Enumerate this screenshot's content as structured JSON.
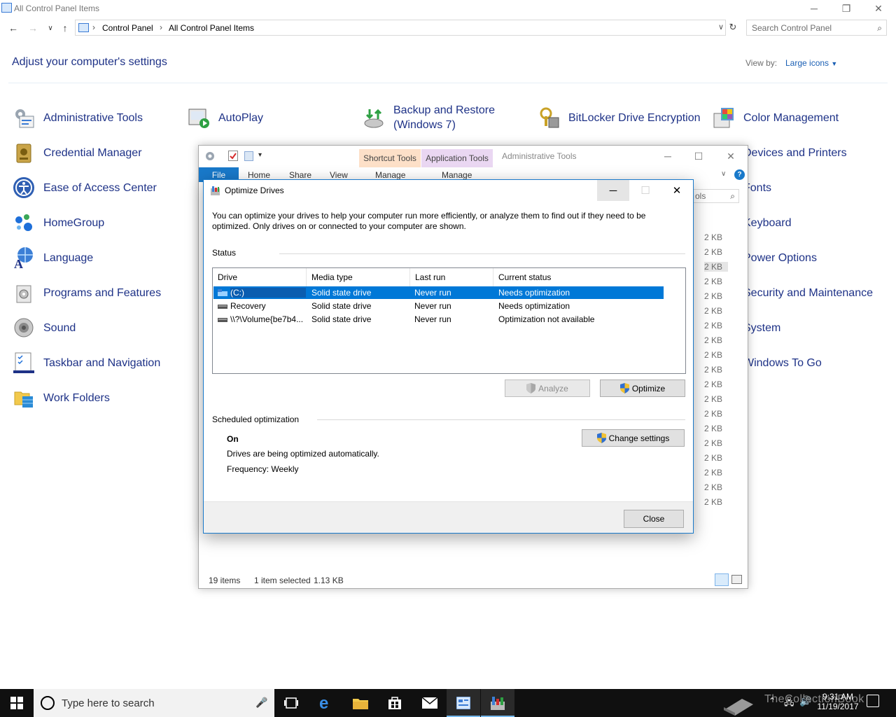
{
  "window": {
    "title": "All Control Panel Items"
  },
  "address": {
    "crumbs": [
      "Control Panel",
      "All Control Panel Items"
    ]
  },
  "search": {
    "placeholder": "Search Control Panel"
  },
  "heading": "Adjust your computer's settings",
  "view_by": {
    "label": "View by:",
    "value": "Large icons"
  },
  "items": [
    {
      "label": "Administrative Tools",
      "icon": "administrative-tools-icon"
    },
    {
      "label": "AutoPlay",
      "icon": "autoplay-icon"
    },
    {
      "label": "Backup and Restore (Windows 7)",
      "icon": "backup-restore-icon"
    },
    {
      "label": "BitLocker Drive Encryption",
      "icon": "bitlocker-icon"
    },
    {
      "label": "Color Management",
      "icon": "color-management-icon"
    },
    {
      "label": "Credential Manager",
      "icon": "credential-manager-icon"
    },
    {
      "label": "Devices and Printers",
      "icon": "devices-printers-icon"
    },
    {
      "label": "Ease of Access Center",
      "icon": "ease-of-access-icon"
    },
    {
      "label": "Fonts",
      "icon": "fonts-icon"
    },
    {
      "label": "HomeGroup",
      "icon": "homegroup-icon"
    },
    {
      "label": "Keyboard",
      "icon": "keyboard-icon"
    },
    {
      "label": "Language",
      "icon": "language-icon"
    },
    {
      "label": "Power Options",
      "icon": "power-options-icon"
    },
    {
      "label": "Programs and Features",
      "icon": "programs-features-icon"
    },
    {
      "label": "Security and Maintenance",
      "icon": "security-maintenance-icon"
    },
    {
      "label": "Sound",
      "icon": "sound-icon"
    },
    {
      "label": "System",
      "icon": "system-icon"
    },
    {
      "label": "Taskbar and Navigation",
      "icon": "taskbar-navigation-icon"
    },
    {
      "label": "Windows To Go",
      "icon": "windows-to-go-icon"
    },
    {
      "label": "Work Folders",
      "icon": "work-folders-icon"
    }
  ],
  "explorer": {
    "tabs": {
      "shortcut": "Shortcut Tools",
      "application": "Application Tools"
    },
    "title": "Administrative Tools",
    "ribbon": {
      "file": "File",
      "home": "Home",
      "share": "Share",
      "view": "View",
      "manage1": "Manage",
      "manage2": "Manage"
    },
    "search_partial": "ols",
    "size": "2 KB",
    "status": {
      "count": "19 items",
      "selected": "1 item selected",
      "size": "1.13 KB"
    }
  },
  "dialog": {
    "title": "Optimize Drives",
    "description": "You can optimize your drives to help your computer run more efficiently, or analyze them to find out if they need to be optimized. Only drives on or connected to your computer are shown.",
    "status_label": "Status",
    "columns": [
      "Drive",
      "Media type",
      "Last run",
      "Current status"
    ],
    "drives": [
      {
        "drive": "(C:)",
        "media": "Solid state drive",
        "last_run": "Never run",
        "status": "Needs optimization"
      },
      {
        "drive": "Recovery",
        "media": "Solid state drive",
        "last_run": "Never run",
        "status": "Needs optimization"
      },
      {
        "drive": "\\\\?\\Volume{be7b4...",
        "media": "Solid state drive",
        "last_run": "Never run",
        "status": "Optimization not available"
      }
    ],
    "analyze_label": "Analyze",
    "optimize_label": "Optimize",
    "scheduled_label": "Scheduled optimization",
    "schedule_state": "On",
    "schedule_desc": "Drives are being optimized automatically.",
    "frequency": "Frequency: Weekly",
    "change_settings_label": "Change settings",
    "close_label": "Close"
  },
  "taskbar": {
    "search_placeholder": "Type here to search",
    "time": "9:31 AM",
    "date": "11/19/2017",
    "watermark": "TheCollectionBook"
  }
}
